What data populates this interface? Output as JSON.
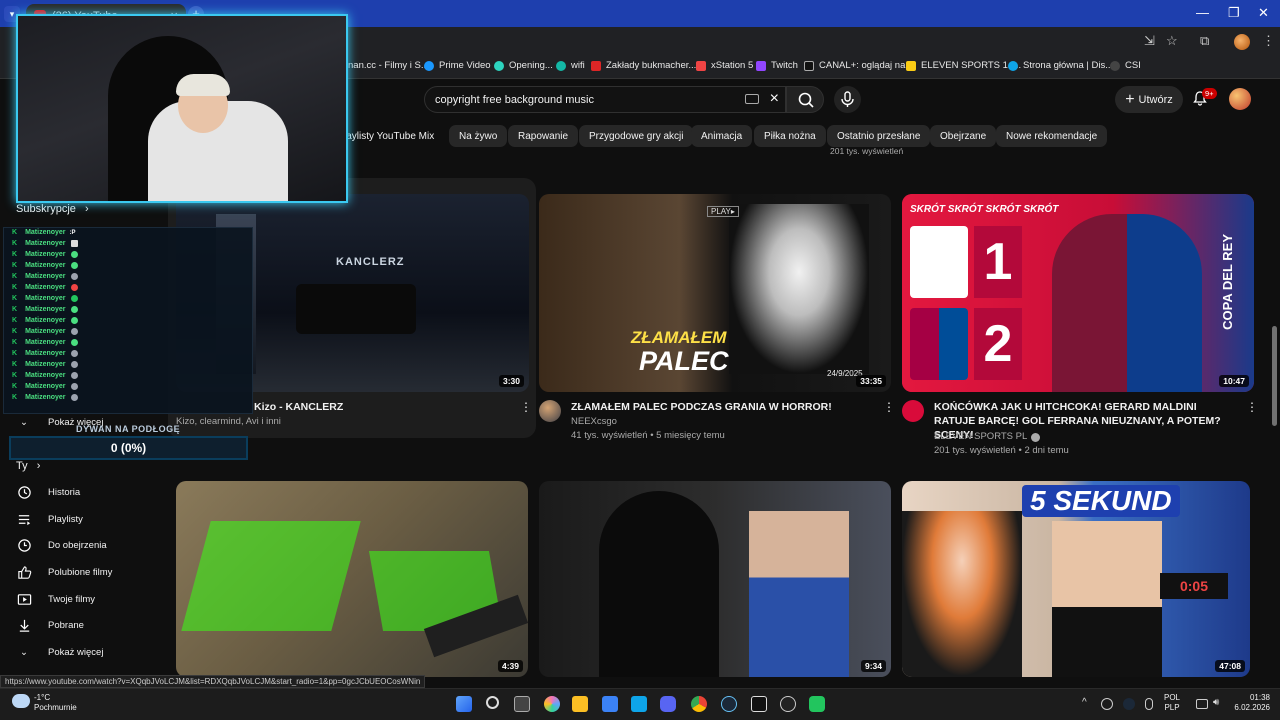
{
  "browser": {
    "tab_title": "(26) YouTube",
    "new_tab_label": "+",
    "bookmarks": [
      "nan.cc - Filmy i S...",
      "Prime Video",
      "Opening...",
      "wifi",
      "Zakłady bukmacher...",
      "xStation 5",
      "Twitch",
      "CANAL+: oglądaj na...",
      "ELEVEN SPORTS 1 t...",
      "Strona główna | Dis...",
      "CSI"
    ],
    "status_url": "https://www.youtube.com/watch?v=XQqbJVoLCJM&list=RDXQqbJVoLCJM&start_radio=1&pp=0gcJCbUEOCosWNin"
  },
  "youtube": {
    "search_value": "copyright free background music",
    "create_label": "Utwórz",
    "notifications_badge": "9+",
    "chips": [
      "laylisty YouTube Mix",
      "Na żywo",
      "Rapowanie",
      "Przygodowe gry akcji",
      "Animacja",
      "Piłka nożna",
      "Ostatnio przesłane",
      "Obejrzane",
      "Nowe rekomendacje"
    ],
    "partial_meta_top": "201 tys. wyświetleń",
    "sidebar": {
      "subscriptions_label": "Subskrypcje",
      "show_more_top": "Pokaż więcej",
      "you_label": "Ty",
      "items": [
        "Historia",
        "Playlisty",
        "Do obejrzenia",
        "Polubione filmy",
        "Twoje filmy",
        "Pobrane",
        "Pokaż więcej"
      ]
    },
    "videos": [
      {
        "title": "Kizo - KANCLERZ",
        "channel": "Kizo, clearmind, Avi i inni",
        "stats": "",
        "duration": "3:30"
      },
      {
        "title": "ZŁAMAŁEM PALEC PODCZAS GRANIA W HORROR!",
        "channel": "NEEXcsgo",
        "stats": "41 tys. wyświetleń • 5 miesięcy temu",
        "duration": "33:35"
      },
      {
        "title": "KOŃCÓWKA JAK U HITCHCOKA! GERARD MALDINI RATUJE BARCĘ! GOL FERRANA NIEUZNANY, A POTEM? SCENY!",
        "channel": "ELEVEN SPORTS PL",
        "stats": "201 tys. wyświetleń • 2 dni temu",
        "duration": "10:47"
      },
      {
        "duration": "4:39"
      },
      {
        "duration": "9:34"
      },
      {
        "duration": "47:08"
      }
    ],
    "thumb_text": {
      "palec_line1": "ZŁAMAŁEM",
      "palec_line2": "PALEC",
      "palec_play": "PLAY▸",
      "palec_date": "24/9/2025",
      "score_banner": "SKRÓT SKRÓT SKRÓT SKRÓT",
      "score_home": "1",
      "score_away": "2",
      "copa": "COPA DEL REY",
      "sekund": "5 SEKUND",
      "kanclerz_sign": "KANCLERZ"
    }
  },
  "stream_overlay": {
    "chat_user": "Matizenoyer",
    "chat_lines": 16,
    "goal_label": "DYWAN NA PODŁOGĘ",
    "goal_value": "0 (0%)"
  },
  "taskbar": {
    "weather_temp": "-1°C",
    "weather_desc": "Pochmurnie",
    "lang_line1": "POL",
    "lang_line2": "PLP",
    "time": "01:38",
    "date": "6.02.2026"
  }
}
